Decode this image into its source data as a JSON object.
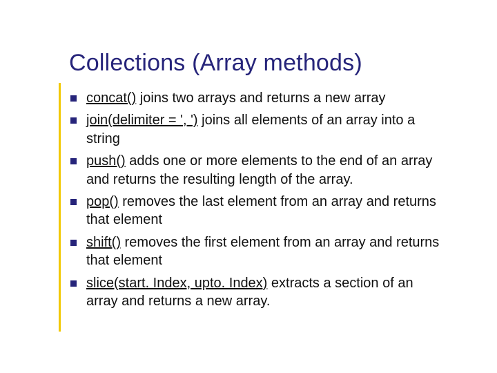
{
  "title": "Collections (Array methods)",
  "items": [
    {
      "method": "concat()",
      "desc": " joins two arrays and returns a new array"
    },
    {
      "method": "join(delimiter = ', ')",
      "desc": " joins all elements of an array into a string"
    },
    {
      "method": "push()",
      "desc": " adds one or more elements to the end of an array and returns the resulting length of the array."
    },
    {
      "method": "pop()",
      "desc": " removes the last element from an array and returns that element"
    },
    {
      "method": "shift()",
      "desc": " removes the first element from an array and returns that element"
    },
    {
      "method": "slice(start. Index, upto. Index)",
      "desc": " extracts a section of an array and returns a new array."
    }
  ]
}
